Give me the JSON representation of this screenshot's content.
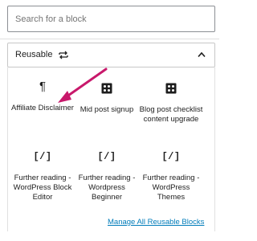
{
  "search": {
    "placeholder": "Search for a block",
    "value": ""
  },
  "panel": {
    "title": "Reusable",
    "icon": "reusable-block-icon",
    "toggle_icon": "chevron-up-icon",
    "expanded": true
  },
  "blocks": [
    {
      "label": "Affiliate Disclaimer",
      "icon": "paragraph-icon",
      "glyph": "¶"
    },
    {
      "label": "Mid post signup",
      "icon": "image-block-icon",
      "glyph": ""
    },
    {
      "label": "Blog post checklist content upgrade",
      "icon": "image-block-icon",
      "glyph": ""
    },
    {
      "label": "Further reading - WordPress Block Editor",
      "icon": "reusable-icon",
      "glyph": "[/]"
    },
    {
      "label": "Further reading - Wordpress Beginner",
      "icon": "reusable-icon",
      "glyph": "[/]"
    },
    {
      "label": "Further reading - WordPress Themes",
      "icon": "reusable-icon",
      "glyph": "[/]"
    }
  ],
  "footer": {
    "manage_link": "Manage All Reusable Blocks"
  },
  "colors": {
    "accent_link": "#007cba",
    "annotation_arrow": "#c8186b",
    "border": "#c7c7c7",
    "text": "#1e1e1e"
  }
}
